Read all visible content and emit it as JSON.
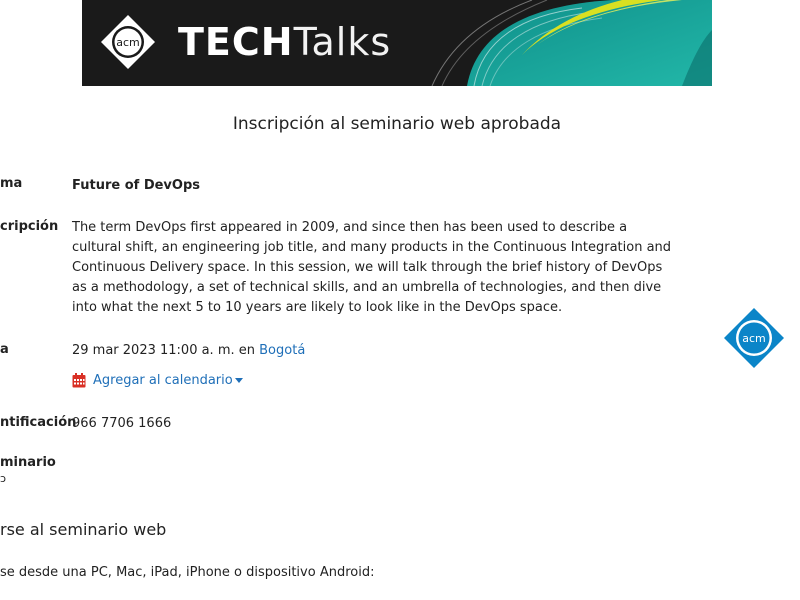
{
  "banner": {
    "logo_text": "acm",
    "title_bold": "TECH",
    "title_light": "Talks"
  },
  "heading": "Inscripción al seminario web aprobada",
  "fields": {
    "topic": {
      "label": "ma",
      "value": "Future of DevOps"
    },
    "description": {
      "label": "cripción",
      "value": "The term DevOps first appeared in 2009, and since then has been used to describe a cultural shift, an engineering job title, and many products in the Continuous Integration and Continuous Delivery space. In this session, we will talk through the brief history of DevOps as a methodology, a set of technical skills, and an umbrella of technologies, and then dive into what the next 5 to 10 years are likely to look like in the DevOps space."
    },
    "date": {
      "label": "a",
      "value": "29 mar 2023 11:00 a. m. en",
      "timezone_link": "Bogotá",
      "add_to_calendar": "Agregar al calendario"
    },
    "id": {
      "label": "ntificación",
      "value": "966 7706 1666"
    },
    "passcode": {
      "label": "minario",
      "label_line2": "ɔ"
    }
  },
  "join_section": {
    "title": "rse al seminario web",
    "instructions": "se desde una PC, Mac, iPad, iPhone o dispositivo Android:"
  },
  "side_logo_text": "acm",
  "colors": {
    "link": "#1f6fb8",
    "calendar_icon": "#d93025",
    "banner_bg": "#1a1a1a",
    "acm_blue": "#0b85c8",
    "teal": "#17a6a0",
    "lime": "#d9e021"
  },
  "icons": {
    "calendar": "calendar-icon",
    "dropdown": "caret-down-icon"
  }
}
